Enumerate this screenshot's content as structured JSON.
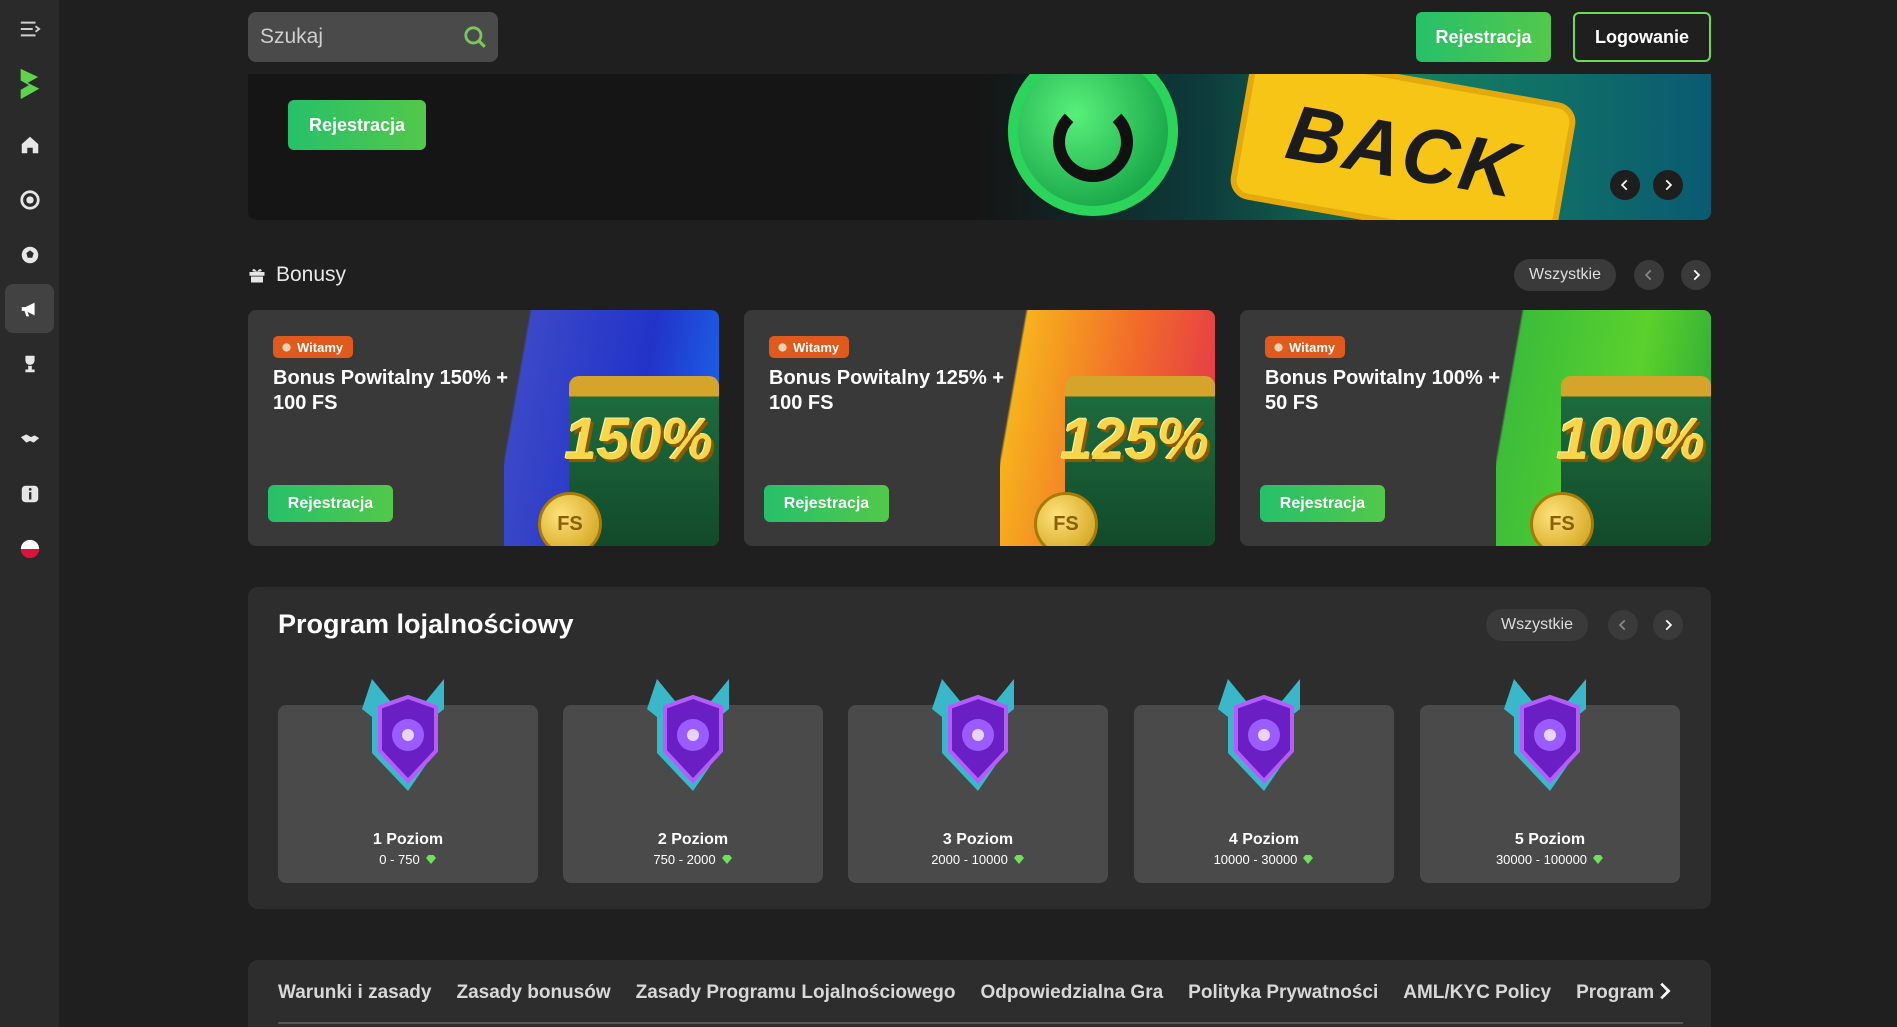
{
  "sidebar": {
    "items": [
      {
        "name": "menu-toggle-icon"
      },
      {
        "name": "brand-logo-icon"
      },
      {
        "name": "home-icon"
      },
      {
        "name": "casino-chip-icon"
      },
      {
        "name": "sports-ball-icon"
      },
      {
        "name": "promotions-megaphone-icon"
      },
      {
        "name": "trophy-icon"
      },
      {
        "name": "support-handshake-icon"
      },
      {
        "name": "info-icon"
      },
      {
        "name": "language-flag-icon"
      }
    ]
  },
  "header": {
    "search_placeholder": "Szukaj",
    "register_label": "Rejestracja",
    "login_label": "Logowanie"
  },
  "banner": {
    "register_label": "Rejestracja",
    "art_text": "BACK"
  },
  "bonuses": {
    "title": "Bonusy",
    "all_label": "Wszystkie",
    "cards": [
      {
        "badge": "Witamy",
        "title": "Bonus Powitalny 150% + 100 FS",
        "button": "Rejestracja",
        "percent": "150%",
        "coin": "FS"
      },
      {
        "badge": "Witamy",
        "title": "Bonus Powitalny 125% + 100 FS",
        "button": "Rejestracja",
        "percent": "125%",
        "coin": "FS"
      },
      {
        "badge": "Witamy",
        "title": "Bonus Powitalny 100% + 50 FS",
        "button": "Rejestracja",
        "percent": "100%",
        "coin": "FS"
      }
    ]
  },
  "loyalty": {
    "title": "Program lojalnościowy",
    "all_label": "Wszystkie",
    "levels": [
      {
        "name": "1 Poziom",
        "range": "0 - 750"
      },
      {
        "name": "2 Poziom",
        "range": "750 - 2000"
      },
      {
        "name": "3 Poziom",
        "range": "2000 - 10000"
      },
      {
        "name": "4 Poziom",
        "range": "10000 - 30000"
      },
      {
        "name": "5 Poziom",
        "range": "30000 - 100000"
      }
    ]
  },
  "footer": {
    "links": [
      "Warunki i zasady",
      "Zasady bonusów",
      "Zasady Programu Lojalnościowego",
      "Odpowiedzialna Gra",
      "Polityka Prywatności",
      "AML/KYC Policy",
      "Program"
    ]
  },
  "colors": {
    "accent_green": "#3fc45a",
    "badge_orange": "#e05a1e",
    "background": "#1f1f1f"
  }
}
